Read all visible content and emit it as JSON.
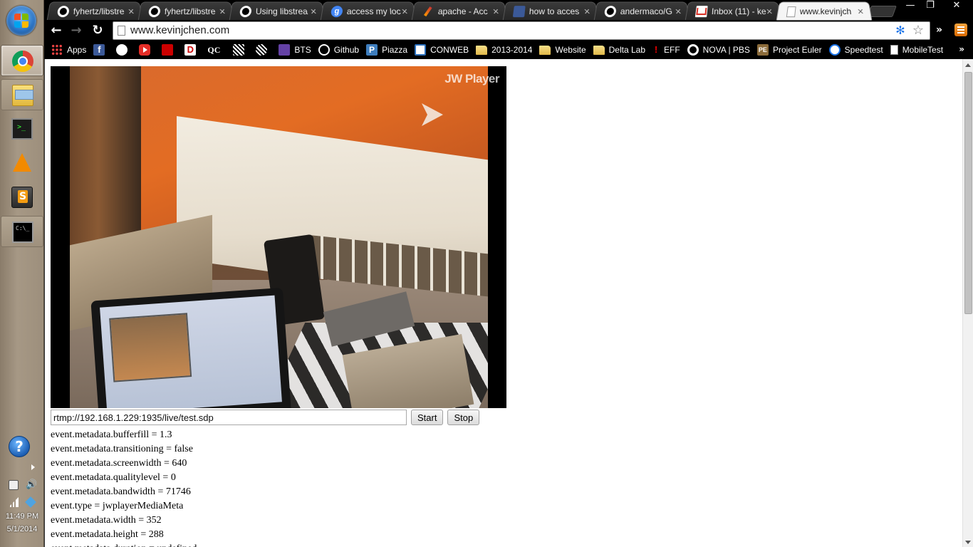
{
  "taskbar": {
    "pinned": [
      {
        "name": "chrome",
        "icon": "chrome-icon"
      },
      {
        "name": "explorer",
        "icon": "folder-icon"
      },
      {
        "name": "terminal",
        "icon": "terminal-icon"
      },
      {
        "name": "vlc",
        "icon": "vlc-icon"
      },
      {
        "name": "sublime",
        "icon": "sublime-icon"
      },
      {
        "name": "cmd",
        "icon": "cmd-icon"
      }
    ],
    "clock": {
      "time": "11:49 PM",
      "date": "5/1/2014"
    }
  },
  "browser": {
    "tabs": [
      {
        "title": "fyhertz/libstre",
        "favicon": "github-icon"
      },
      {
        "title": "fyhertz/libstre",
        "favicon": "github-icon"
      },
      {
        "title": "Using libstrea",
        "favicon": "github-icon"
      },
      {
        "title": "access my loc",
        "favicon": "google-icon"
      },
      {
        "title": "apache - Acc",
        "favicon": "apache-icon"
      },
      {
        "title": "how to acces",
        "favicon": "msdn-icon"
      },
      {
        "title": "andermaco/G",
        "favicon": "github-icon"
      },
      {
        "title": "Inbox (11) - ke",
        "favicon": "gmail-icon"
      },
      {
        "title": "www.kevinjch",
        "favicon": "page-icon",
        "active": true
      }
    ],
    "url": "www.kevinjchen.com",
    "bookmarks": {
      "apps": "Apps",
      "icon_only": [
        "facebook-icon",
        "reddit-icon",
        "youtube-icon",
        "red-icon",
        "d-icon",
        "qc-icon",
        "pattern-icon",
        "pattern2-icon"
      ],
      "items": [
        {
          "label": "BTS",
          "icon": "twitch-icon"
        },
        {
          "label": "Github",
          "icon": "github-icon"
        },
        {
          "label": "Piazza",
          "icon": "piazza-icon"
        },
        {
          "label": "CONWEB",
          "icon": "conweb-icon"
        },
        {
          "label": "2013-2014",
          "icon": "folder-icon"
        },
        {
          "label": "Website",
          "icon": "folder-icon"
        },
        {
          "label": "Delta Lab",
          "icon": "folder-icon"
        },
        {
          "label": "EFF",
          "icon": "eff-icon"
        },
        {
          "label": "NOVA | PBS",
          "icon": "nova-icon"
        },
        {
          "label": "Project Euler",
          "icon": "project-euler-icon"
        },
        {
          "label": "Speedtest",
          "icon": "speedtest-icon"
        },
        {
          "label": "MobileTest",
          "icon": "page-icon"
        }
      ]
    }
  },
  "page": {
    "player": {
      "watermark": "JW Player"
    },
    "stream_url": "rtmp://192.168.1.229:1935/live/test.sdp",
    "start_label": "Start",
    "stop_label": "Stop",
    "event_log": [
      "event.metadata.bufferfill = 1.3",
      "event.metadata.transitioning = false",
      "event.metadata.screenwidth = 640",
      "event.metadata.qualitylevel = 0",
      "event.metadata.bandwidth = 71746",
      "event.type = jwplayerMediaMeta",
      "event.metadata.width = 352",
      "event.metadata.height = 288",
      "event.metadata.duration = undefined"
    ]
  }
}
